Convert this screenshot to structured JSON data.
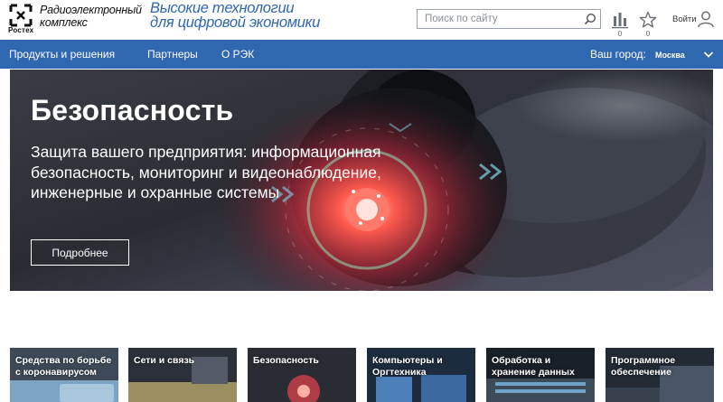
{
  "header": {
    "logo": {
      "line1": "Радиоэлектронный",
      "line2": "комплекс",
      "brand": "Ростех"
    },
    "tagline": {
      "line1": "Высокие технологии",
      "line2": "для цифровой экономики"
    },
    "search": {
      "placeholder": "Поиск по сайту",
      "value": ""
    },
    "compare": {
      "icon": "bar-chart-icon",
      "count": "0"
    },
    "favorites": {
      "icon": "star-icon",
      "count": "0"
    },
    "login": {
      "label": "Войти",
      "icon": "user-icon"
    }
  },
  "nav": {
    "items": [
      {
        "label": "Продукты и решения"
      },
      {
        "label": "Партнеры"
      },
      {
        "label": "О РЭК"
      }
    ],
    "city_label": "Ваш город:",
    "city_value": "Москва"
  },
  "hero": {
    "title": "Безопасность",
    "description": "Защита вашего предприятия: информационная безопасность, мониторинг и видеонаблюдение, инженерные и охранные системы",
    "button_label": "Подробнее"
  },
  "tiles": [
    {
      "label": "Средства по борьбе с коронавирусом"
    },
    {
      "label": "Сети и связь"
    },
    {
      "label": "Безопасность"
    },
    {
      "label": "Компьютеры и Оргтехника"
    },
    {
      "label": "Обработка и хранение данных"
    },
    {
      "label": "Программное обеспечение"
    }
  ],
  "colors": {
    "brand_blue": "#2f67b1",
    "hero_glow": "#ff5a4e",
    "text_dark": "#111111"
  }
}
